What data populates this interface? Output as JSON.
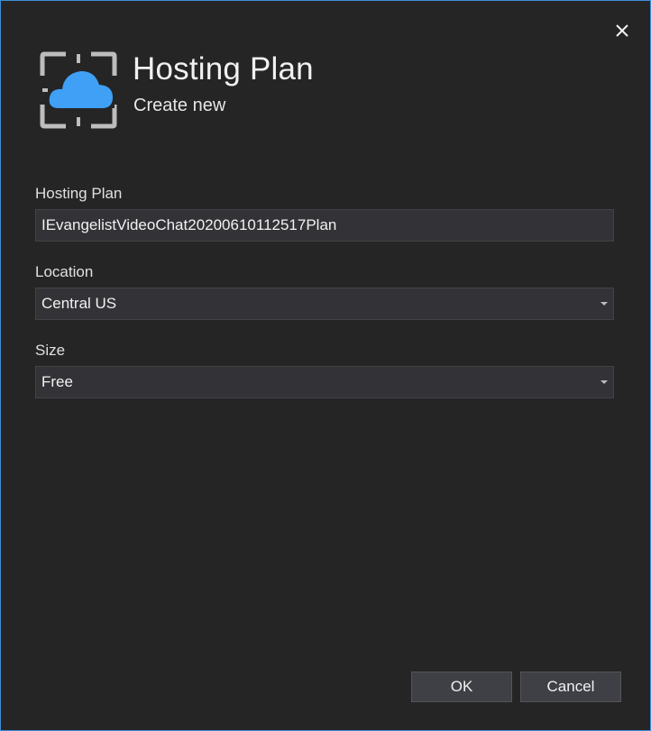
{
  "dialog": {
    "title": "Hosting Plan",
    "subtitle": "Create new",
    "accent_color": "#3e8ed9",
    "cloud_color": "#3fa0f5"
  },
  "form": {
    "hosting_plan": {
      "label": "Hosting Plan",
      "value": "IEvangelistVideoChat20200610112517Plan"
    },
    "location": {
      "label": "Location",
      "selected": "Central US"
    },
    "size": {
      "label": "Size",
      "selected": "Free"
    }
  },
  "buttons": {
    "ok_label": "OK",
    "cancel_label": "Cancel"
  },
  "icons": {
    "close": "close-icon",
    "header": "cloud-icon",
    "dropdown": "chevron-down-icon"
  }
}
